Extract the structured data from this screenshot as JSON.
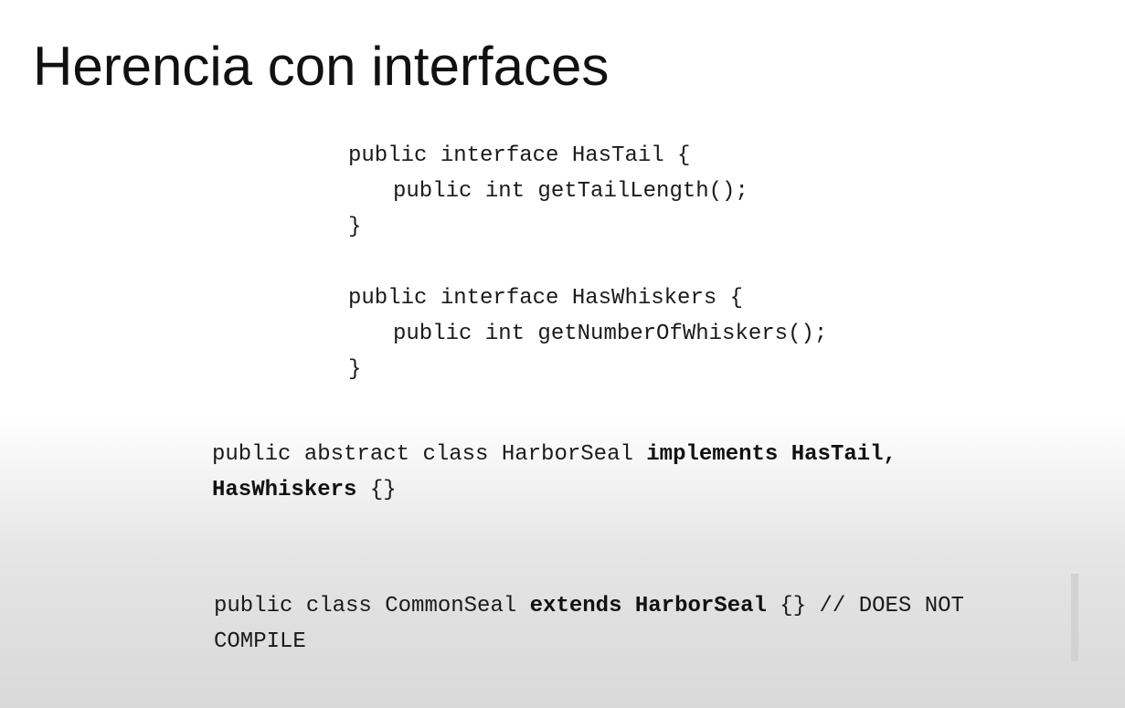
{
  "slide": {
    "title": "Herencia con interfaces"
  },
  "code": {
    "hastail": {
      "line1": "public interface HasTail {",
      "line2": "public int getTailLength();",
      "line3": "}"
    },
    "haswhiskers": {
      "line1": "public interface HasWhiskers {",
      "line2": "public int getNumberOfWhiskers();",
      "line3": "}"
    },
    "harborseal": {
      "line1_plain": "public abstract class HarborSeal ",
      "line1_bold": "implements HasTail,",
      "line2_bold": "HasWhiskers",
      "line2_plain": " {}"
    },
    "commonseal": {
      "line1_plain_a": "public class CommonSeal ",
      "line1_bold": "extends HarborSeal",
      "line1_plain_b": " {} // DOES NOT",
      "line2_plain": "COMPILE"
    }
  }
}
